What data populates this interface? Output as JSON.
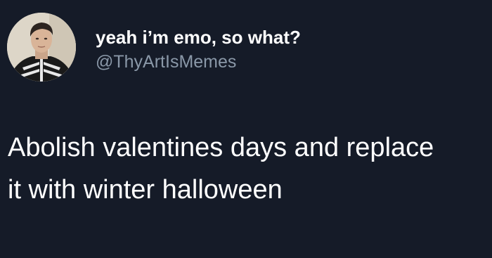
{
  "tweet": {
    "author": {
      "display_name": "yeah i’m emo, so what?",
      "handle": "@ThyArtIsMemes",
      "avatar_icon": "profile-photo"
    },
    "text_lines": [
      "Abolish valentines days and replace",
      "it with winter halloween"
    ]
  },
  "colors": {
    "background": "#151b28",
    "display_name": "#ffffff",
    "handle": "#8a98a8",
    "body_text": "#ffffff"
  }
}
